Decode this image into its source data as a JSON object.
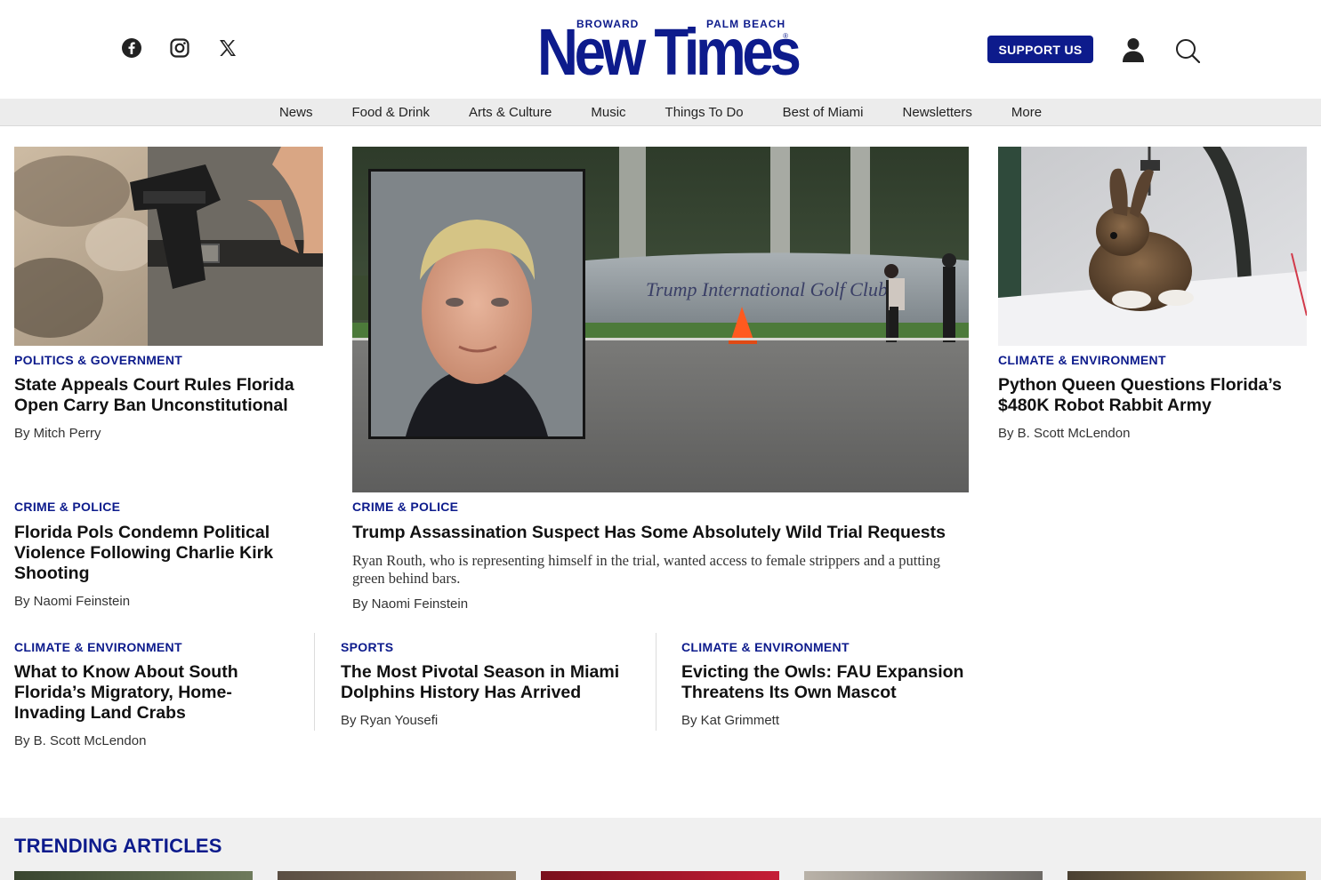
{
  "header": {
    "social": [
      {
        "icon": "facebook-icon"
      },
      {
        "icon": "instagram-icon"
      },
      {
        "icon": "x-twitter-icon"
      }
    ],
    "logo": {
      "kicker_left": "BROWARD",
      "kicker_right": "PALM BEACH",
      "wordmark": "New Times",
      "registered": "®"
    },
    "support_label": "SUPPORT US",
    "brand_color": "#0d1b8c"
  },
  "nav": {
    "items": [
      "News",
      "Food & Drink",
      "Arts & Culture",
      "Music",
      "Things To Do",
      "Best of Miami",
      "Newsletters",
      "More"
    ]
  },
  "articles": {
    "left_top": {
      "category": "POLITICS & GOVERNMENT",
      "headline": "State Appeals Court Rules Florida Open Carry Ban Unconstitutional",
      "byline": "By Mitch Perry",
      "image": "holstered-handgun-photo"
    },
    "feature": {
      "category": "CRIME & POLICE",
      "headline": "Trump Assassination Suspect Has Some Absolutely Wild Trial Requests",
      "dek": "Ryan Routh, who is representing himself in the trial, wanted access to female strippers and a putting green behind bars.",
      "byline": "By Naomi Feinstein",
      "image": "mugshot-over-golf-club-photo",
      "sign_text": "Trump International Golf Club"
    },
    "right_top": {
      "category": "CLIMATE & ENVIRONMENT",
      "headline": "Python Queen Questions Florida’s $480K Robot Rabbit Army",
      "byline": "By B. Scott McLendon",
      "image": "robot-rabbit-photo"
    },
    "left_mid": {
      "category": "CRIME & POLICE",
      "headline": "Florida Pols Condemn Political Violence Following Charlie Kirk Shooting",
      "byline": "By Naomi Feinstein"
    },
    "row": [
      {
        "category": "CLIMATE & ENVIRONMENT",
        "headline": "What to Know About South Florida’s Migratory, Home-Invading Land Crabs",
        "byline": "By B. Scott McLendon"
      },
      {
        "category": "SPORTS",
        "headline": "The Most Pivotal Season in Miami Dolphins History Has Arrived",
        "byline": "By Ryan Yousefi"
      },
      {
        "category": "CLIMATE & ENVIRONMENT",
        "headline": "Evicting the Owls: FAU Expansion Threatens Its Own Mascot",
        "byline": "By Kat Grimmett"
      }
    ]
  },
  "trending": {
    "title": "TRENDING ARTICLES"
  }
}
